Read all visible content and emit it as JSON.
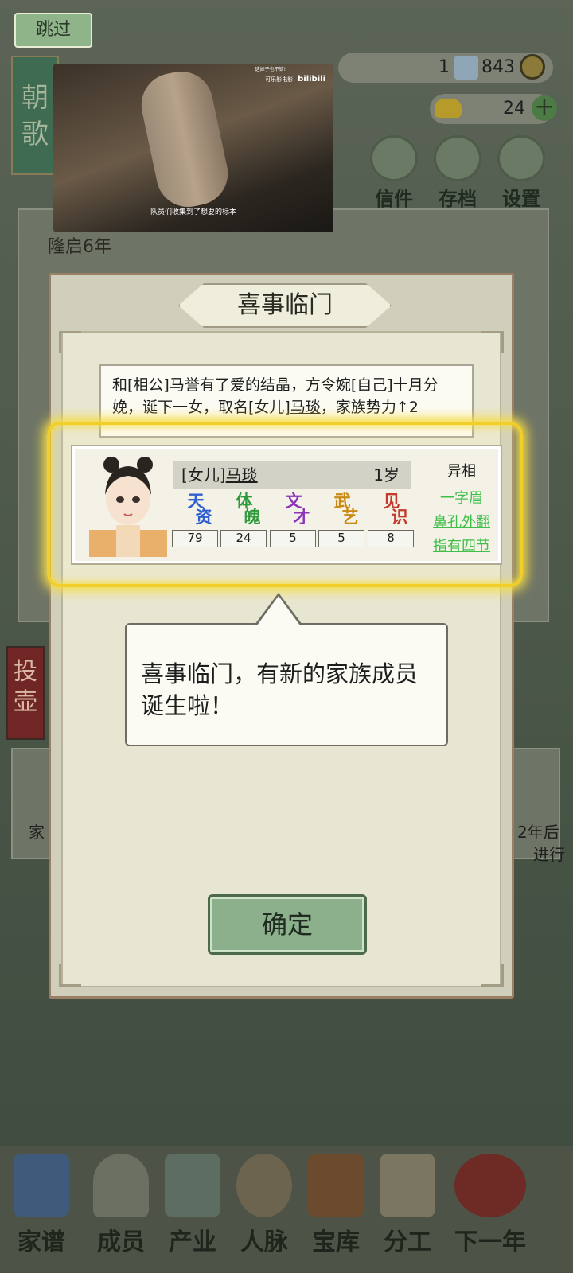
{
  "top": {
    "skip_label": "跳过",
    "currency_count": "1",
    "coins": "843",
    "gold": "24",
    "buttons": [
      {
        "label": "信件",
        "icon": "letter-icon"
      },
      {
        "label": "存档",
        "icon": "save-brush-icon"
      },
      {
        "label": "设置",
        "icon": "settings-gear-icon"
      }
    ],
    "side_title": "朝歌"
  },
  "video": {
    "subtitle": "队员们收集到了想要的标本",
    "top_caption": "这妹子也不错!",
    "channel": "可乐影电影",
    "brand": "bilibili"
  },
  "background": {
    "year": "隆启6年",
    "side_tag": "投壶",
    "left_text": "家",
    "right_text_1": "2年后",
    "right_text_2": "进行"
  },
  "dialog": {
    "title": "喜事临门",
    "event_text": {
      "p1": "和[相公]",
      "husband": "马誉",
      "p2": "有了爱的结晶，",
      "mother": "方令婉",
      "p3": "[自己]十月分娩，诞下一女，取名[女儿]",
      "child": "马琰",
      "p4": "，家族势力↑2"
    },
    "card": {
      "relation": "[女儿]",
      "name": "马琰",
      "age": "1岁",
      "stats": [
        {
          "label1": "天",
          "label2": "资",
          "value": "79",
          "color": "#2f5fd0"
        },
        {
          "label1": "体",
          "label2": "魄",
          "value": "24",
          "color": "#2e9a3c"
        },
        {
          "label1": "文",
          "label2": "才",
          "value": "5",
          "color": "#8d35b8"
        },
        {
          "label1": "武",
          "label2": "艺",
          "value": "5",
          "color": "#c98a12"
        },
        {
          "label1": "见",
          "label2": "识",
          "value": "8",
          "color": "#c43a2c"
        }
      ],
      "traits_heading": "异相",
      "traits": [
        "一字眉",
        "鼻孔外翻",
        "指有四节"
      ]
    },
    "bubble_line1": "喜事临门，有新的家族成员",
    "bubble_line2": "诞生啦！",
    "confirm_label": "确定"
  },
  "nav": [
    {
      "label": "家谱",
      "icon": "genealogy-book-icon"
    },
    {
      "label": "成员",
      "icon": "members-person-icon"
    },
    {
      "label": "产业",
      "icon": "industry-building-icon"
    },
    {
      "label": "人脉",
      "icon": "network-web-icon"
    },
    {
      "label": "宝库",
      "icon": "treasure-chest-icon"
    },
    {
      "label": "分工",
      "icon": "scroll-assign-icon"
    },
    {
      "label": "下一年",
      "icon": "lantern-spring-icon"
    }
  ]
}
